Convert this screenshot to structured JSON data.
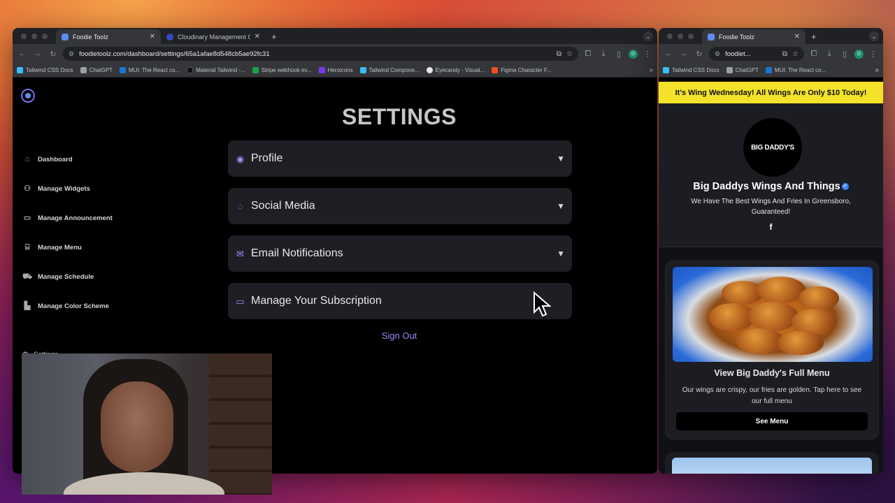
{
  "left_window": {
    "tabs": [
      {
        "title": "Foodie Toolz",
        "active": true
      },
      {
        "title": "Cloudinary Management Con",
        "active": false
      }
    ],
    "url": "foodietoolz.com/dashboard/settings/65a1afae8d548cb5ae92fc31",
    "profile_initial": "D",
    "bookmarks": [
      {
        "label": "Tailwind CSS Docs",
        "color": "#38bdf8"
      },
      {
        "label": "ChatGPT",
        "color": "#9aa0a6"
      },
      {
        "label": "MUI: The React co...",
        "color": "#1976d2"
      },
      {
        "label": "Material Tailwind -...",
        "color": "#111111"
      },
      {
        "label": "Stripe webhook ev...",
        "color": "#16a34a"
      },
      {
        "label": "Heroicons",
        "color": "#7c3aed"
      },
      {
        "label": "Tailwind Compone...",
        "color": "#38bdf8"
      },
      {
        "label": "Eyecandy - Visual...",
        "color": "#e5e7eb"
      },
      {
        "label": "Figma Character F...",
        "color": "#f24e1e"
      }
    ],
    "sidebar": {
      "items": [
        {
          "label": "Dashboard",
          "icon": "home-icon",
          "glyph": "⌂"
        },
        {
          "label": "Manage Widgets",
          "icon": "users-icon",
          "glyph": "⚇"
        },
        {
          "label": "Manage Announcement",
          "icon": "chat-icon",
          "glyph": "▭"
        },
        {
          "label": "Manage Menu",
          "icon": "store-icon",
          "glyph": "⌸"
        },
        {
          "label": "Manage Schedule",
          "icon": "truck-icon",
          "glyph": "⛟"
        },
        {
          "label": "Manage Color Scheme",
          "icon": "palette-icon",
          "glyph": "▙"
        }
      ],
      "settings_label": "Settings"
    },
    "page_title": "SETTINGS",
    "accordions": [
      {
        "label": "Profile",
        "icon": "user-circle-icon",
        "glyph": "◉",
        "expandable": true
      },
      {
        "label": "Social Media",
        "icon": "chat-bubble-icon",
        "glyph": "◌",
        "expandable": true
      },
      {
        "label": "Email Notifications",
        "icon": "envelope-icon",
        "glyph": "✉",
        "expandable": true
      },
      {
        "label": "Manage Your Subscription",
        "icon": "credit-card-icon",
        "glyph": "▭",
        "expandable": false
      }
    ],
    "sign_out": "Sign Out"
  },
  "right_window": {
    "tabs": [
      {
        "title": "Foodie Toolz",
        "active": true
      }
    ],
    "url": "foodiet...",
    "profile_initial": "D",
    "bookmarks": [
      {
        "label": "Tailwind CSS Docs",
        "color": "#38bdf8"
      },
      {
        "label": "ChatGPT",
        "color": "#9aa0a6"
      },
      {
        "label": "MUI: The React co...",
        "color": "#1976d2"
      }
    ],
    "banner": "It's Wing Wednesday! All Wings Are Only $10 Today!",
    "logo_text": "BIG DADDY'S",
    "business_name": "Big Daddys Wings And Things",
    "tagline": "We Have The Best Wings And Fries In Greensboro, Guaranteed!",
    "social_icon": "f",
    "menu_card": {
      "title": "View Big Daddy's Full Menu",
      "description": "Our wings are crispy, our fries are golden. Tap here to see our full menu",
      "button": "See Menu"
    }
  }
}
